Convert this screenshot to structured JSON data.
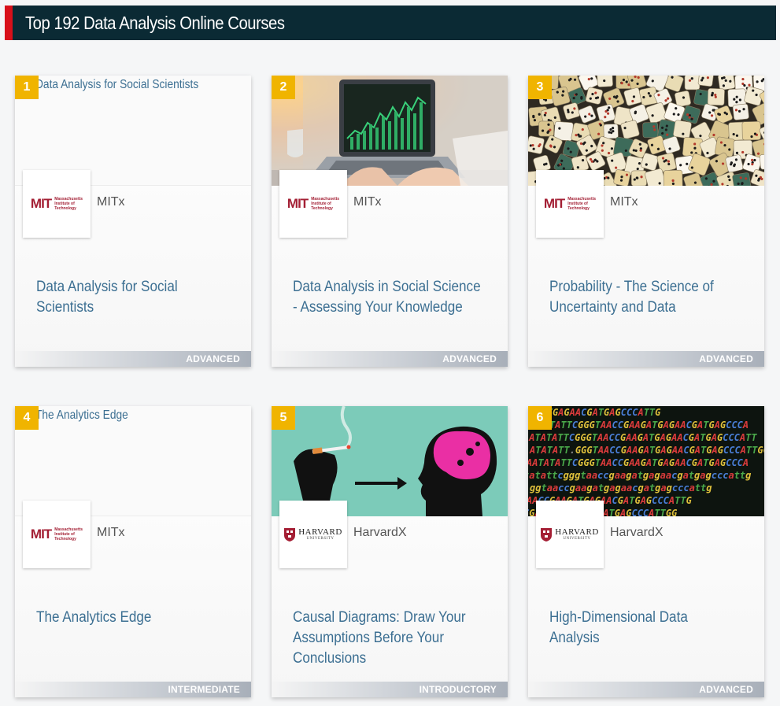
{
  "page": {
    "title": "Top 192 Data Analysis Online Courses"
  },
  "mit_logo": {
    "mark": "MIT",
    "line1": "Massachusetts",
    "line2": "Institute of",
    "line3": "Technology"
  },
  "harvard_logo": {
    "name": "HARVARD",
    "sub": "UNIVERSITY"
  },
  "courses": [
    {
      "rank": "1",
      "image_alt": "Data Analysis for Social Scientists",
      "provider": "MITx",
      "title": "Data Analysis for Social Scientists",
      "level": "ADVANCED"
    },
    {
      "rank": "2",
      "provider": "MITx",
      "title": "Data Analysis in Social Science - Assessing Your Knowledge",
      "level": "ADVANCED"
    },
    {
      "rank": "3",
      "provider": "MITx",
      "title": "Probability - The Science of Uncertainty and Data",
      "level": "ADVANCED"
    },
    {
      "rank": "4",
      "image_alt": "The Analytics Edge",
      "provider": "MITx",
      "title": "The Analytics Edge",
      "level": "INTERMEDIATE"
    },
    {
      "rank": "5",
      "provider": "HarvardX",
      "title": "Causal Diagrams: Draw Your Assumptions Before Your Conclusions",
      "level": "INTRODUCTORY"
    },
    {
      "rank": "6",
      "provider": "HarvardX",
      "title": "High-Dimensional Data Analysis",
      "level": "ADVANCED"
    }
  ],
  "dna_lines": [
    "AGATGAGAACGATGAGCCCATTG",
    "AATATATTCGGGTAACCGAAGATGAGAACGATGAGCCCA",
    "AATATATTCGGGTAACCGAAGATGAGAACGATGAGCCCATT",
    "ATATATT.GGGTAACCGAAGATGAGAACGATGAGCCCATTGG",
    "AATATATTCGGGTAACCGAAGATGAGAACGATGAGCCCA",
    "tatattcgggtaaccgaagatgagaacgatgagcccattg",
    "ggtaaccgaagatgagaacgatgagcccattg",
    "AACCGAAGATGAGAACGATGAGCCCATTG",
    "CGAAGATGAGAACGATGAGCCCATTGG"
  ]
}
